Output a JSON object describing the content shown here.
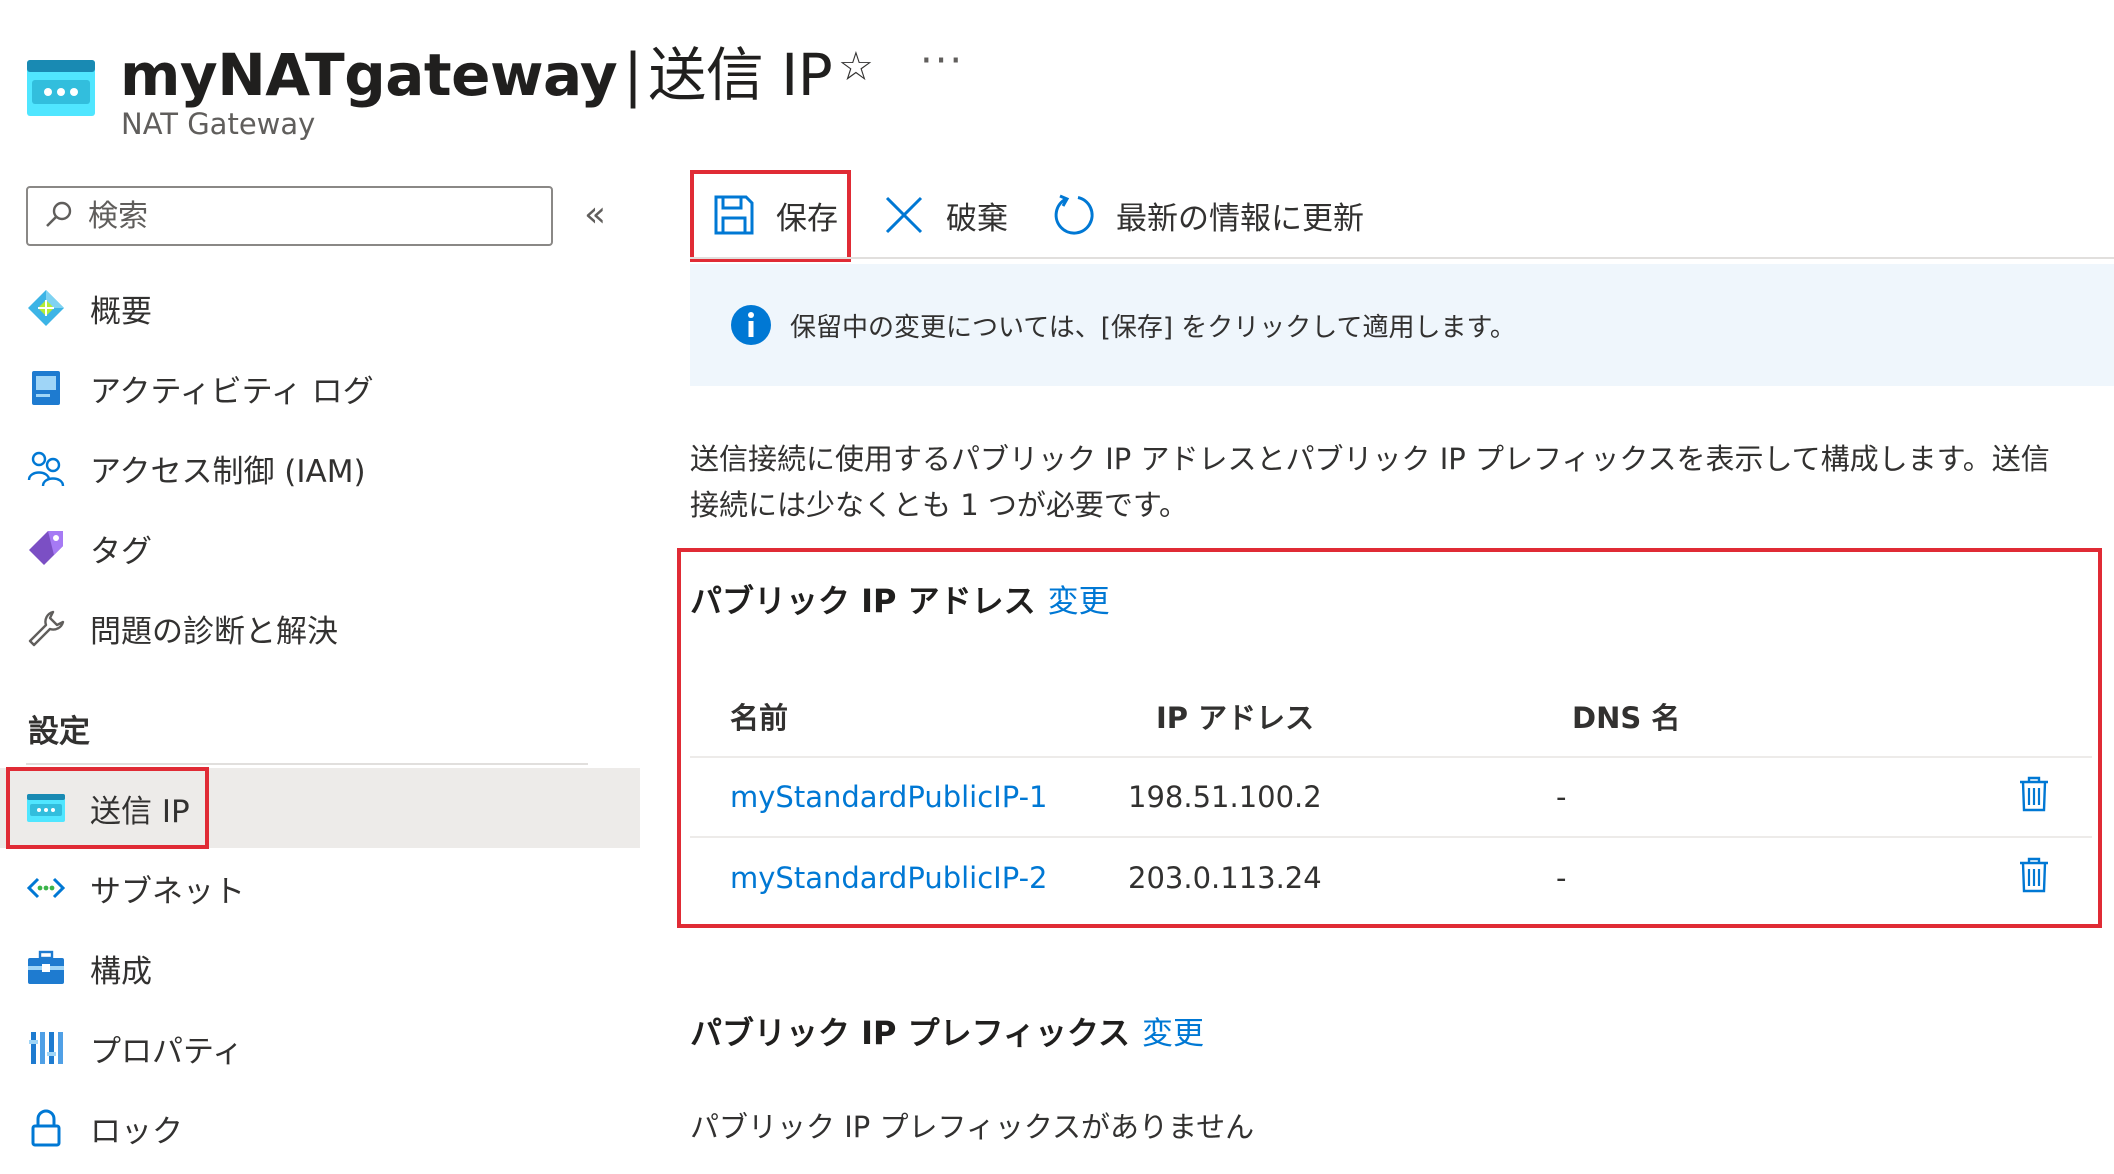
{
  "header": {
    "title": "myNATgateway",
    "separator": "|",
    "page": "送信 IP",
    "subtitle": "NAT Gateway",
    "more": "···"
  },
  "sidebar": {
    "search_placeholder": "検索",
    "collapse_glyph": "«",
    "items": [
      {
        "label": "概要",
        "icon": "overview-icon"
      },
      {
        "label": "アクティビティ ログ",
        "icon": "activity-log-icon"
      },
      {
        "label": "アクセス制御 (IAM)",
        "icon": "iam-icon"
      },
      {
        "label": "タグ",
        "icon": "tag-icon"
      },
      {
        "label": "問題の診断と解決",
        "icon": "wrench-icon"
      }
    ],
    "section_label": "設定",
    "settings_items": [
      {
        "label": "送信 IP",
        "icon": "outbound-ip-icon",
        "selected": true
      },
      {
        "label": "サブネット",
        "icon": "subnet-icon"
      },
      {
        "label": "構成",
        "icon": "configuration-icon"
      },
      {
        "label": "プロパティ",
        "icon": "properties-icon"
      },
      {
        "label": "ロック",
        "icon": "lock-icon"
      }
    ]
  },
  "toolbar": {
    "save_label": "保存",
    "discard_label": "破棄",
    "refresh_label": "最新の情報に更新"
  },
  "banner": {
    "text": "保留中の変更については、[保存] をクリックして適用します。"
  },
  "description": "送信接続に使用するパブリック IP アドレスとパブリック IP プレフィックスを表示して構成します。送信接続には少なくとも 1 つが必要です。",
  "public_ip": {
    "title": "パブリック IP アドレス",
    "change_link": "変更",
    "columns": [
      "名前",
      "IP アドレス",
      "DNS 名"
    ],
    "rows": [
      {
        "name": "myStandardPublicIP-1",
        "ip": "198.51.100.2",
        "dns": "-"
      },
      {
        "name": "myStandardPublicIP-2",
        "ip": "203.0.113.24",
        "dns": "-"
      }
    ]
  },
  "public_prefix": {
    "title": "パブリック IP プレフィックス",
    "change_link": "変更",
    "empty_text": "パブリック IP プレフィックスがありません"
  },
  "colors": {
    "accent": "#0078d4",
    "highlight": "#e02b35",
    "banner_bg": "#eff6fc",
    "selected_bg": "#edebe9"
  }
}
